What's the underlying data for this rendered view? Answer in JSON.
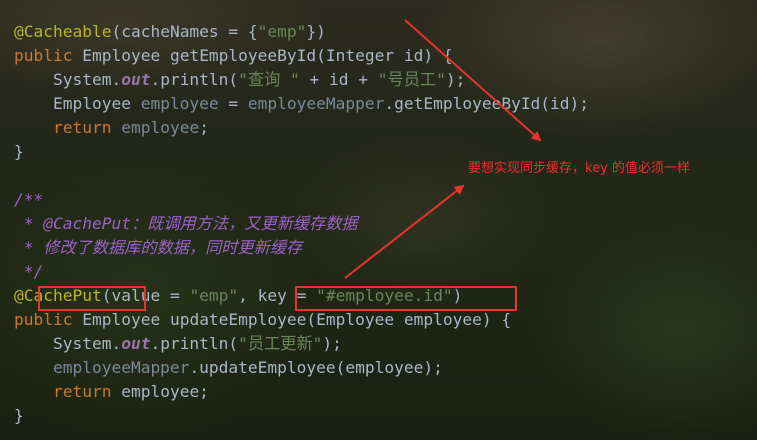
{
  "code_lines": [
    {
      "tokens": [
        {
          "t": "@Cacheable",
          "c": "ann"
        },
        {
          "t": "(cacheNames = {",
          "c": "id"
        },
        {
          "t": "\"emp\"",
          "c": "str"
        },
        {
          "t": "})",
          "c": "id"
        }
      ]
    },
    {
      "tokens": [
        {
          "t": "public ",
          "c": "kw"
        },
        {
          "t": "Employee ",
          "c": "id"
        },
        {
          "t": "getEmployeeById",
          "c": "fn"
        },
        {
          "t": "(Integer id) {",
          "c": "id"
        }
      ]
    },
    {
      "tokens": [
        {
          "t": "    System.",
          "c": "id"
        },
        {
          "t": "out",
          "c": "fld"
        },
        {
          "t": ".println(",
          "c": "id"
        },
        {
          "t": "\"查询 \"",
          "c": "str"
        },
        {
          "t": " + id + ",
          "c": "id"
        },
        {
          "t": "\"号员工\"",
          "c": "str"
        },
        {
          "t": ");",
          "c": "id"
        }
      ]
    },
    {
      "tokens": [
        {
          "t": "    Employee ",
          "c": "id"
        },
        {
          "t": "employee",
          "c": "var"
        },
        {
          "t": " = ",
          "c": "id"
        },
        {
          "t": "employeeMapper",
          "c": "var"
        },
        {
          "t": ".getEmployeeById(id);",
          "c": "id"
        }
      ]
    },
    {
      "tokens": [
        {
          "t": "    ",
          "c": "id"
        },
        {
          "t": "return ",
          "c": "kw"
        },
        {
          "t": "employee",
          "c": "var"
        },
        {
          "t": ";",
          "c": "id"
        }
      ]
    },
    {
      "tokens": [
        {
          "t": "}",
          "c": "id"
        }
      ]
    },
    {
      "tokens": [
        {
          "t": "",
          "c": "id"
        }
      ]
    },
    {
      "tokens": [
        {
          "t": "/**",
          "c": "cmt-doc"
        }
      ]
    },
    {
      "tokens": [
        {
          "t": " * @CachePut：既调用方法，又更新缓存数据",
          "c": "cmt-doc"
        }
      ]
    },
    {
      "tokens": [
        {
          "t": " * 修改了数据库的数据，同时更新缓存",
          "c": "cmt-doc"
        }
      ]
    },
    {
      "tokens": [
        {
          "t": " */",
          "c": "cmt-doc"
        }
      ]
    },
    {
      "tokens": [
        {
          "t": "@CachePut",
          "c": "ann"
        },
        {
          "t": "(value = ",
          "c": "id"
        },
        {
          "t": "\"emp\"",
          "c": "str"
        },
        {
          "t": ", key = ",
          "c": "id"
        },
        {
          "t": "\"#employee.id\"",
          "c": "str"
        },
        {
          "t": ")",
          "c": "id"
        }
      ]
    },
    {
      "tokens": [
        {
          "t": "public ",
          "c": "kw"
        },
        {
          "t": "Employee ",
          "c": "id"
        },
        {
          "t": "updateEmployee",
          "c": "fn"
        },
        {
          "t": "(Employee employee) {",
          "c": "id"
        }
      ]
    },
    {
      "tokens": [
        {
          "t": "    System.",
          "c": "id"
        },
        {
          "t": "out",
          "c": "fld"
        },
        {
          "t": ".println(",
          "c": "id"
        },
        {
          "t": "\"员工更新\"",
          "c": "str"
        },
        {
          "t": ");",
          "c": "id"
        }
      ]
    },
    {
      "tokens": [
        {
          "t": "    ",
          "c": "id"
        },
        {
          "t": "employeeMapper",
          "c": "var"
        },
        {
          "t": ".updateEmployee(employee);",
          "c": "id"
        }
      ]
    },
    {
      "tokens": [
        {
          "t": "    ",
          "c": "id"
        },
        {
          "t": "return ",
          "c": "kw"
        },
        {
          "t": "employee;",
          "c": "id"
        }
      ]
    },
    {
      "tokens": [
        {
          "t": "}",
          "c": "id"
        }
      ]
    }
  ],
  "annotation": {
    "text": "要想实现同步缓存，key 的值必须一样",
    "color": "#e8332e"
  }
}
